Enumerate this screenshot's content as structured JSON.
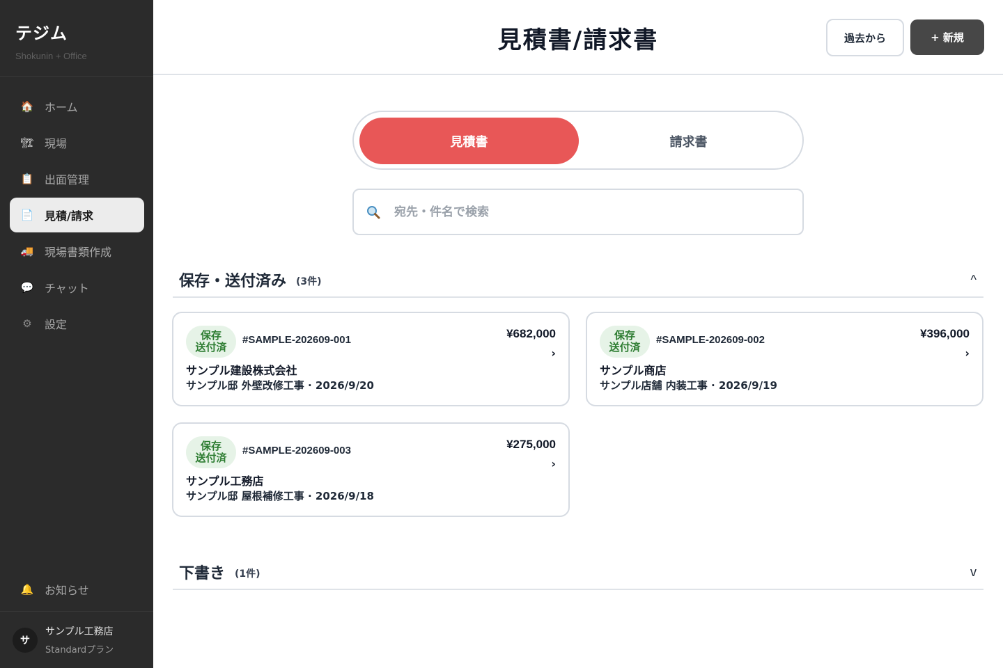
{
  "brand": {
    "title": "テジム",
    "subtitle": "Shokunin + Office"
  },
  "sidebar": {
    "items": [
      {
        "label": "ホーム",
        "icon": "house-icon",
        "glyph": "🏠"
      },
      {
        "label": "現場",
        "icon": "building-icon",
        "glyph": "🏗"
      },
      {
        "label": "出面管理",
        "icon": "clipboard-icon",
        "glyph": "📋"
      },
      {
        "label": "見積/請求",
        "icon": "document-icon",
        "glyph": "📄"
      },
      {
        "label": "現場書類作成",
        "icon": "truck-icon",
        "glyph": "🚚"
      },
      {
        "label": "チャット",
        "icon": "chat-bubble-icon",
        "glyph": "💬"
      },
      {
        "label": "設定",
        "icon": "gear-icon",
        "glyph": "⚙"
      }
    ],
    "notice": {
      "label": "お知らせ",
      "icon": "bell-icon",
      "glyph": "🔔"
    },
    "user": {
      "avatar": "サ",
      "name": "サンプル工務店",
      "plan": "Standardプラン"
    }
  },
  "header": {
    "title": "見積書/請求書",
    "past_label": "過去から",
    "new_label": "+ 新規"
  },
  "tabs": {
    "estimate": "見積書",
    "invoice": "請求書"
  },
  "search": {
    "placeholder": "宛先・件名で検索"
  },
  "sections": {
    "saved": {
      "title": "保存・送付済み",
      "count": "(3件)",
      "chevron": "^"
    },
    "draft": {
      "title": "下書き",
      "count": "(1件)",
      "chevron": "v"
    }
  },
  "cards": [
    {
      "status_1": "保存",
      "status_2": "送付済",
      "number": "#SAMPLE-202609-001",
      "amount": "¥682,000",
      "arrow": "›",
      "client": "サンプル建設株式会社",
      "subject": "サンプル邸 外壁改修工事 · 2026/9/20"
    },
    {
      "status_1": "保存",
      "status_2": "送付済",
      "number": "#SAMPLE-202609-002",
      "amount": "¥396,000",
      "arrow": "›",
      "client": "サンプル商店",
      "subject": "サンプル店舗 内装工事 · 2026/9/19"
    },
    {
      "status_1": "保存",
      "status_2": "送付済",
      "number": "#SAMPLE-202609-003",
      "amount": "¥275,000",
      "arrow": "›",
      "client": "サンプル工務店",
      "subject": "サンプル邸 屋根補修工事 · 2026/9/18"
    }
  ],
  "colors": {
    "sidebar_bg": "#2b2b2b",
    "accent": "#e85757",
    "status_bg": "#e6f3e7",
    "status_fg": "#2e7d32",
    "primary_btn": "#474747"
  }
}
